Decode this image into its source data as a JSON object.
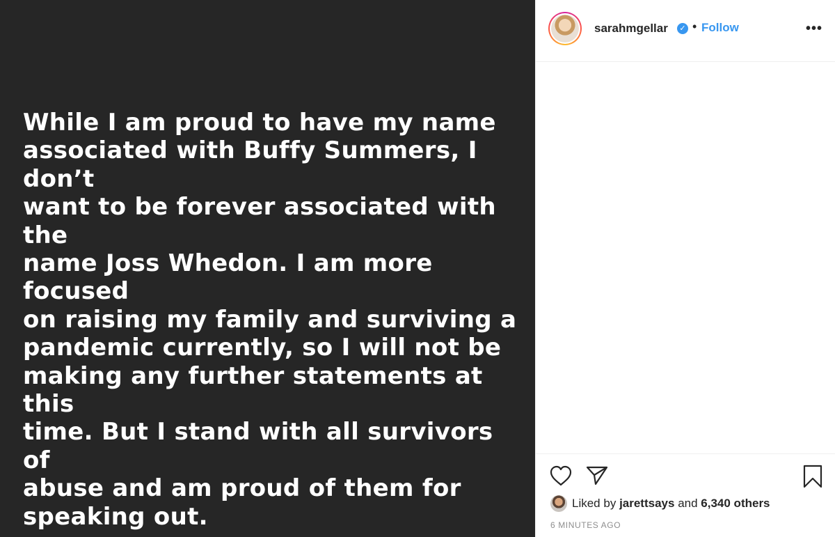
{
  "post": {
    "text": "While I am proud to have my name\nassociated with Buffy Summers, I don’t\nwant to be forever associated with the\nname Joss Whedon. I am more focused\non raising my family and surviving a\npandemic currently, so I will not be\nmaking any further statements at this\ntime. But I stand with all survivors of\nabuse and am proud of them for\nspeaking out."
  },
  "header": {
    "username": "sarahmgellar",
    "separator": "•",
    "follow_label": "Follow",
    "more_label": "•••"
  },
  "likes": {
    "prefix": "Liked by",
    "user": "jarettsays",
    "joiner": "and",
    "others": "6,340 others"
  },
  "timestamp": "6 MINUTES AGO",
  "icons": {
    "verified": "verified-badge-icon",
    "like": "heart-icon",
    "share": "paper-plane-icon",
    "save": "bookmark-icon"
  },
  "colors": {
    "media_bg": "#262626",
    "link": "#3897f0",
    "muted": "#8e8e8e"
  }
}
